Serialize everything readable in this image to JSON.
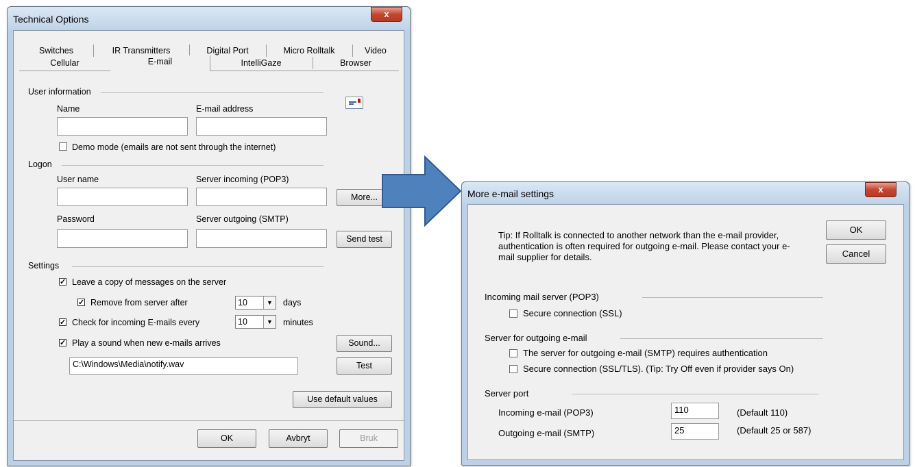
{
  "technical_options": {
    "title": "Technical Options",
    "close_glyph": "x",
    "tabs_row1": [
      "Switches",
      "IR Transmitters",
      "Digital Port",
      "Micro Rolltalk",
      "Video"
    ],
    "tabs_row2": [
      "Cellular",
      "E-mail",
      "IntelliGaze",
      "Browser"
    ],
    "active_tab": "E-mail",
    "user_info": {
      "group_label": "User information",
      "name_label": "Name",
      "name_value": "",
      "email_label": "E-mail address",
      "email_value": "",
      "demo_mode_label": "Demo mode (emails are not sent through the internet)",
      "demo_mode_checked": false
    },
    "logon": {
      "group_label": "Logon",
      "username_label": "User name",
      "username_value": "",
      "pop3_label": "Server incoming (POP3)",
      "pop3_value": "",
      "more_button": "More...",
      "password_label": "Password",
      "password_value": "",
      "smtp_label": "Server outgoing (SMTP)",
      "smtp_value": "",
      "send_test_button": "Send test"
    },
    "settings": {
      "group_label": "Settings",
      "leave_copy_label": "Leave a copy of messages on the server",
      "leave_copy_checked": true,
      "remove_after_label": "Remove from server after",
      "remove_after_checked": true,
      "remove_after_value": "10",
      "remove_after_unit": "days",
      "check_every_label": "Check for incoming E-mails every",
      "check_every_checked": true,
      "check_every_value": "10",
      "check_every_unit": "minutes",
      "play_sound_label": "Play a sound when new e-mails arrives",
      "play_sound_checked": true,
      "sound_button": "Sound...",
      "sound_path": "C:\\Windows\\Media\\notify.wav",
      "test_button": "Test",
      "defaults_button": "Use default values"
    },
    "footer": {
      "ok": "OK",
      "cancel": "Avbryt",
      "apply": "Bruk"
    }
  },
  "more_settings": {
    "title": "More e-mail settings",
    "close_glyph": "x",
    "tip": "Tip: If Rolltalk is connected to another network than the e-mail provider, authentication is often required for outgoing e-mail. Please contact your e-mail supplier for details.",
    "ok_button": "OK",
    "cancel_button": "Cancel",
    "incoming_group": "Incoming mail server (POP3)",
    "incoming_ssl_label": "Secure connection (SSL)",
    "outgoing_group": "Server for outgoing e-mail",
    "smtp_auth_label": "The server for outgoing e-mail (SMTP) requires authentication",
    "smtp_ssl_label": "Secure connection (SSL/TLS). (Tip: Try Off even if provider says On)",
    "port_group": "Server port",
    "incoming_port_label": "Incoming e-mail (POP3)",
    "incoming_port_value": "110",
    "incoming_port_default": "(Default 110)",
    "outgoing_port_label": "Outgoing e-mail (SMTP)",
    "outgoing_port_value": "25",
    "outgoing_port_default": "(Default 25 or 587)"
  },
  "colors": {
    "arrow_fill": "#4f81bd",
    "arrow_stroke": "#2f5b8f",
    "close_button": "#c7452f"
  }
}
